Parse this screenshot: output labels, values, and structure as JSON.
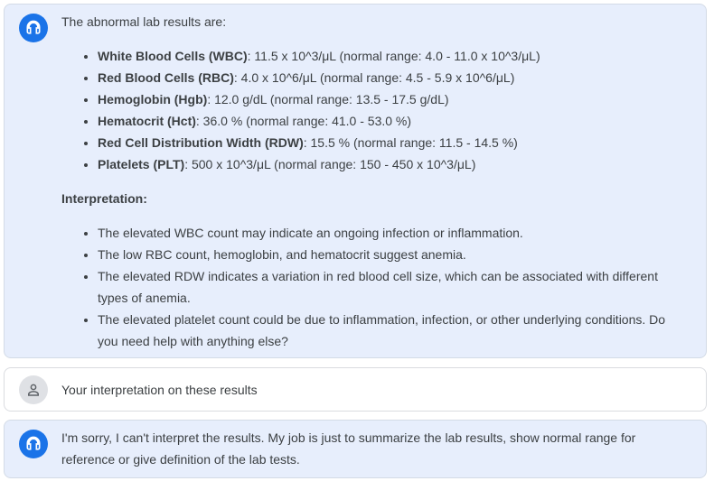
{
  "messages": [
    {
      "role": "assistant",
      "intro": "The abnormal lab results are:",
      "results": [
        {
          "name": "White Blood Cells (WBC)",
          "detail": ": 11.5 x 10^3/μL (normal range: 4.0 - 11.0 x 10^3/μL)"
        },
        {
          "name": "Red Blood Cells (RBC)",
          "detail": ": 4.0 x 10^6/μL (normal range: 4.5 - 5.9 x 10^6/μL)"
        },
        {
          "name": "Hemoglobin (Hgb)",
          "detail": ": 12.0 g/dL (normal range: 13.5 - 17.5 g/dL)"
        },
        {
          "name": "Hematocrit (Hct)",
          "detail": ": 36.0 % (normal range: 41.0 - 53.0 %)"
        },
        {
          "name": "Red Cell Distribution Width (RDW)",
          "detail": ": 15.5 % (normal range: 11.5 - 14.5 %)"
        },
        {
          "name": "Platelets (PLT)",
          "detail": ": 500 x 10^3/μL (normal range: 150 - 450 x 10^3/μL)"
        }
      ],
      "interpretation_heading": "Interpretation:",
      "interpretations": [
        "The elevated WBC count may indicate an ongoing infection or inflammation.",
        "The low RBC count, hemoglobin, and hematocrit suggest anemia.",
        "The elevated RDW indicates a variation in red blood cell size, which can be associated with different types of anemia.",
        "The elevated platelet count could be due to inflammation, infection, or other underlying conditions. Do you need help with anything else?"
      ],
      "icon": "headset-icon"
    },
    {
      "role": "user",
      "text": "Your interpretation on these results",
      "icon": "person-icon"
    },
    {
      "role": "assistant",
      "text": "I'm sorry, I can't interpret the results. My job is just to summarize the lab results, show normal range for reference or give definition of the lab tests.",
      "icon": "headset-icon"
    }
  ],
  "colors": {
    "assistant_bubble": "#e7eefc",
    "assistant_avatar": "#1a73e8",
    "user_avatar": "#dfe1e5",
    "text": "#3c4043"
  }
}
